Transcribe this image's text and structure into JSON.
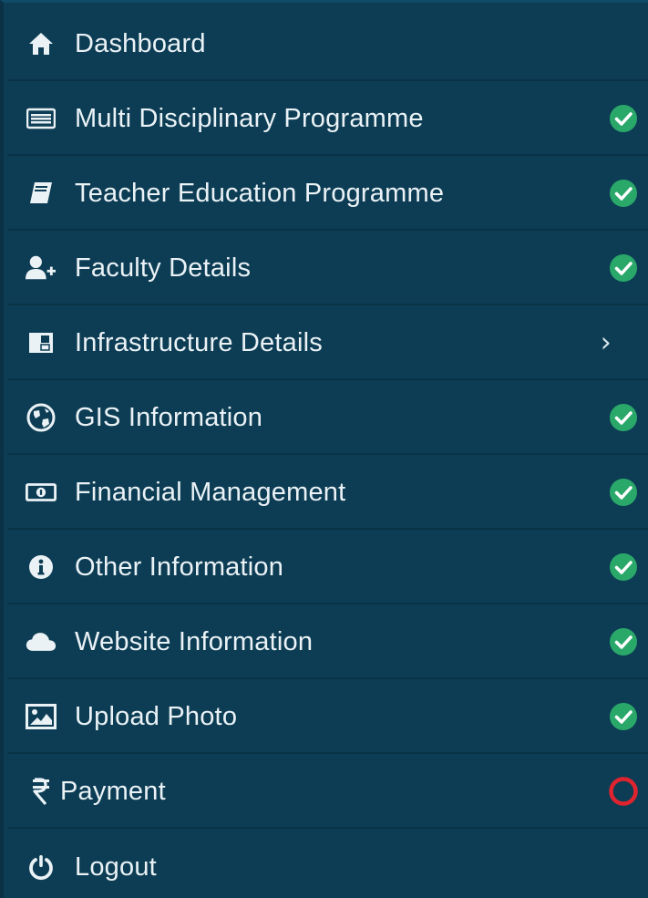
{
  "colors": {
    "sidebar_bg": "#0d3d54",
    "divider": "#0a3246",
    "text": "#eaf2f6",
    "check_green": "#2aa86a",
    "pending_red": "#e0242f"
  },
  "menu": {
    "items": [
      {
        "label": "Dashboard",
        "icon": "home-icon",
        "status": "none"
      },
      {
        "label": "Multi Disciplinary Programme",
        "icon": "list-icon",
        "status": "complete"
      },
      {
        "label": "Teacher Education Programme",
        "icon": "book-icon",
        "status": "complete"
      },
      {
        "label": "Faculty Details",
        "icon": "user-plus-icon",
        "status": "complete"
      },
      {
        "label": "Infrastructure Details",
        "icon": "building-icon",
        "status": "expandable"
      },
      {
        "label": "GIS Information",
        "icon": "globe-icon",
        "status": "complete"
      },
      {
        "label": "Financial Management",
        "icon": "money-icon",
        "status": "complete"
      },
      {
        "label": "Other Information",
        "icon": "info-icon",
        "status": "complete"
      },
      {
        "label": "Website Information",
        "icon": "cloud-icon",
        "status": "complete"
      },
      {
        "label": "Upload Photo",
        "icon": "image-icon",
        "status": "complete"
      },
      {
        "label": "Payment",
        "icon": "rupee-icon",
        "status": "pending"
      },
      {
        "label": "Logout",
        "icon": "power-icon",
        "status": "none"
      }
    ]
  }
}
